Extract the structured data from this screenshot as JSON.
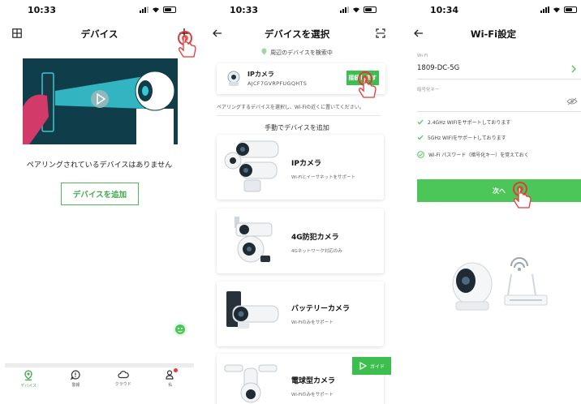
{
  "panel1": {
    "time": "10:33",
    "title": "デバイス",
    "empty_text": "ペアリングされているデバイスはありません",
    "add_button": "デバイスを追加",
    "tabs": [
      {
        "label": "デバイス",
        "icon": "location-pin-icon",
        "active": true
      },
      {
        "label": "警報",
        "icon": "message-alert-icon",
        "active": false
      },
      {
        "label": "クラウド",
        "icon": "cloud-icon",
        "active": false
      },
      {
        "label": "私",
        "icon": "person-icon",
        "active": false
      }
    ]
  },
  "panel2": {
    "time": "10:33",
    "title": "デバイスを選択",
    "scanning_text": "周辺のデバイスを検索中",
    "found_device": {
      "name": "IPカメラ",
      "uid": "AJCF7GVRPFUGQHTS",
      "connect_label": "接続します"
    },
    "hint": "ペアリングするデバイスを選択し、Wi-Fiの近くに置いてください。",
    "manual_title": "手動でデバイスを追加",
    "cards": [
      {
        "title": "IPカメラ",
        "subtitle": "Wi-Fiとイーサネットをサポート"
      },
      {
        "title": "4G防犯カメラ",
        "subtitle": "4Gネットワーク対応のみ"
      },
      {
        "title": "バッテリーカメラ",
        "subtitle": "Wi-Fiのみをサポート"
      },
      {
        "title": "電球型カメラ",
        "subtitle": "Wi-Fiのみをサポート"
      }
    ],
    "guide_label": "ガイド"
  },
  "panel3": {
    "time": "10:34",
    "title": "Wi-Fi設定",
    "wifi_label": "Wi-Fi",
    "wifi_value": "1809-DC-5G",
    "password_label": "暗号化キー",
    "checks": [
      "2.4GHz WIFIをサポートしております",
      "5GHz WIFIをサポートしております"
    ],
    "remember": "Wi-Fi パスワード（暗号化キー）を覚えておく",
    "next_button": "次へ"
  },
  "colors": {
    "accent": "#3dbf4f",
    "hero_bg": "#0f3d49",
    "beam": "#38c9d6",
    "badge": "#e53935"
  }
}
